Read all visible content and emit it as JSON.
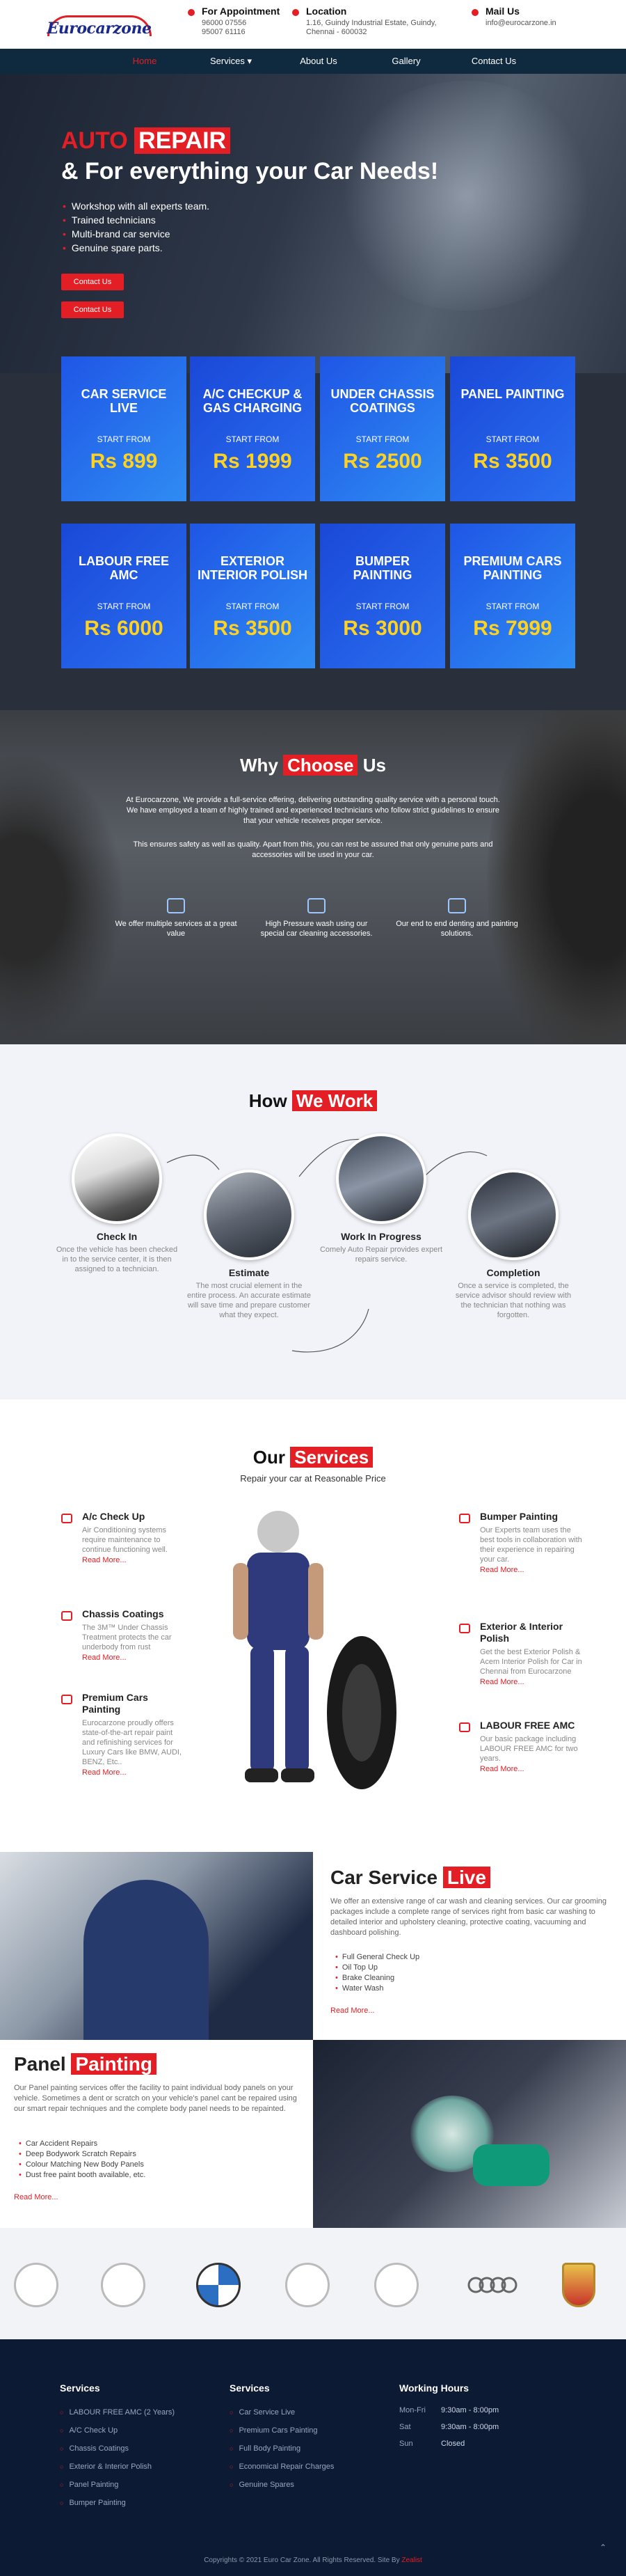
{
  "header": {
    "logo": "Eurocarzone",
    "appointment": {
      "title": "For Appointment",
      "line1": "96000 07556",
      "line2": "95007 61116"
    },
    "location": {
      "title": "Location",
      "line1": "1.16, Guindy Industrial Estate, Guindy,",
      "line2": "Chennai - 600032"
    },
    "mail": {
      "title": "Mail Us",
      "line1": "info@eurocarzone.in"
    }
  },
  "nav": [
    {
      "label": "Home"
    },
    {
      "label": "Services ▾"
    },
    {
      "label": "About Us"
    },
    {
      "label": "Gallery"
    },
    {
      "label": "Contact Us"
    }
  ],
  "hero": {
    "auto": "AUTO",
    "repair": "REPAIR",
    "line2": "& For everything your Car Needs!",
    "bullets": [
      "Workshop with all experts team.",
      "Trained technicians",
      "Multi-brand car service",
      "Genuine spare parts."
    ],
    "btn1": "Contact Us",
    "btn2": "Contact Us"
  },
  "packages": [
    {
      "title": "CAR SERVICE LIVE",
      "start": "START FROM",
      "price": "Rs 899"
    },
    {
      "title": "A/C CHECKUP & GAS CHARGING",
      "start": "START FROM",
      "price": "Rs 1999"
    },
    {
      "title": "UNDER CHASSIS COATINGS",
      "start": "START FROM",
      "price": "Rs 2500"
    },
    {
      "title": "PANEL PAINTING",
      "start": "START FROM",
      "price": "Rs 3500"
    },
    {
      "title": "LABOUR FREE AMC",
      "start": "START FROM",
      "price": "Rs 6000"
    },
    {
      "title": "EXTERIOR INTERIOR POLISH",
      "start": "START FROM",
      "price": "Rs 3500"
    },
    {
      "title": "BUMPER PAINTING",
      "start": "START FROM",
      "price": "Rs 3000"
    },
    {
      "title": "PREMIUM CARS PAINTING",
      "start": "START FROM",
      "price": "Rs 7999"
    }
  ],
  "why": {
    "title_a": "Why",
    "title_b": "Choose",
    "title_c": "Us",
    "p1": "At Eurocarzone, We provide a full-service offering, delivering outstanding quality service with a personal touch. We have employed a team of highly trained and experienced technicians who follow strict guidelines to ensure that your vehicle receives proper service.",
    "p2": "This ensures safety as well as quality. Apart from this, you can rest be assured that only genuine parts and accessories will be used in your car.",
    "features": [
      "We offer multiple services at a great value",
      "High Pressure wash using our special car cleaning accessories.",
      "Our end to end denting and painting solutions."
    ]
  },
  "how": {
    "title_a": "How",
    "title_b": "We Work",
    "steps": [
      {
        "title": "Check In",
        "desc": "Once the vehicle has been checked in to the service center, it is then assigned to a technician."
      },
      {
        "title": "Estimate",
        "desc": "The most crucial element in the entire process. An accurate estimate will save time and prepare customer what they expect."
      },
      {
        "title": "Work In Progress",
        "desc": "Comely Auto Repair provides expert repairs service."
      },
      {
        "title": "Completion",
        "desc": "Once a service is completed, the service advisor should review with the technician that nothing was forgotten."
      }
    ]
  },
  "services": {
    "title_a": "Our",
    "title_b": "Services",
    "subtitle": "Repair your car at Reasonable Price",
    "left": [
      {
        "title": "A/c Check Up",
        "desc": "Air Conditioning systems require maintenance to continue functioning well.",
        "more": "Read More..."
      },
      {
        "title": "Chassis Coatings",
        "desc": "The 3M™ Under Chassis Treatment protects the car underbody from rust",
        "more": "Read More..."
      },
      {
        "title": "Premium Cars Painting",
        "desc": "Eurocarzone proudly offers state-of-the-art repair paint and refinishing services for Luxury Cars like BMW, AUDI, BENZ, Etc..",
        "more": "Read More..."
      }
    ],
    "right": [
      {
        "title": "Bumper Painting",
        "desc": "Our Experts team uses the best tools in collaboration with their experience in repairing your car.",
        "more": "Read More..."
      },
      {
        "title": "Exterior & Interior Polish",
        "desc": "Get the best Exterior Polish & Acem Interior Polish for Car in Chennai from Eurocarzone",
        "more": "Read More..."
      },
      {
        "title": "LABOUR FREE AMC",
        "desc": "Our basic package including LABOUR FREE AMC for two years.",
        "more": "Read More..."
      }
    ]
  },
  "car_service_live": {
    "title_a": "Car Service",
    "title_b": "Live",
    "desc": "We offer an extensive range of car wash and cleaning services. Our car grooming packages include a complete range of services right from basic car washing to detailed interior and upholstery cleaning, protective coating, vacuuming and dashboard polishing.",
    "list": [
      "Full General Check Up",
      "Oil Top Up",
      "Brake Cleaning",
      "Water Wash"
    ],
    "more": "Read More..."
  },
  "panel_painting": {
    "title_a": "Panel",
    "title_b": "Painting",
    "desc": "Our Panel painting services offer the facility to paint individual body panels on your vehicle. Sometimes a dent or scratch on your vehicle's panel cant be repaired using our smart repair techniques and the complete body panel needs to be repainted.",
    "list": [
      "Car Accident Repairs",
      "Deep Bodywork Scratch Repairs",
      "Colour Matching New Body Panels",
      "Dust free paint booth available, etc."
    ],
    "more": "Read More..."
  },
  "brands": [
    "acura-logo",
    "infiniti-logo",
    "bmw-logo",
    "mercedes-logo",
    "lexus-logo",
    "audi-logo",
    "porsche-logo"
  ],
  "footer": {
    "col1_title": "Services",
    "col1": [
      "LABOUR FREE AMC (2 Years)",
      "A/C Check Up",
      "Chassis Coatings",
      "Exterior & Interior Polish",
      "Panel Painting",
      "Bumper Painting"
    ],
    "col2_title": "Services",
    "col2": [
      "Car Service Live",
      "Premium Cars Painting",
      "Full Body Painting",
      "Economical Repair Charges",
      "Genuine Spares"
    ],
    "hours_title": "Working Hours",
    "hours": [
      {
        "day": "Mon-Fri",
        "time": "9:30am - 8:00pm"
      },
      {
        "day": "Sat",
        "time": "9:30am - 8:00pm"
      },
      {
        "day": "Sun",
        "time": "Closed"
      }
    ],
    "copyright": "Copyrights © 2021 Euro Car Zone. All Rights Reserved. Site By",
    "credit": "Zealist"
  },
  "colors": {
    "accent": "#e31e24",
    "nav": "#0f2a3f",
    "card": "#2f7bef",
    "price": "#ffd21f",
    "footer": "#0c1a33"
  }
}
